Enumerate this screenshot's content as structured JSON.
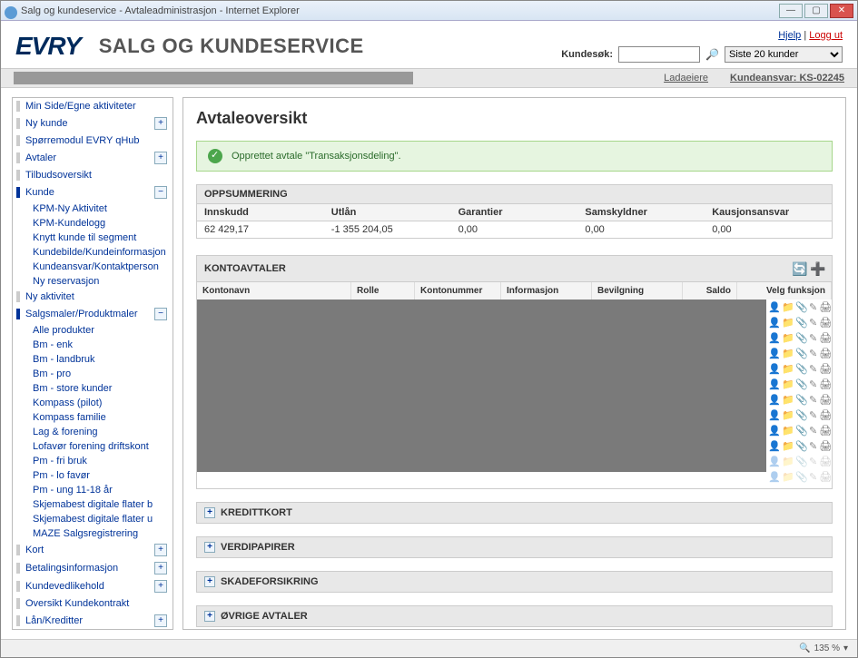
{
  "window": {
    "title": "Salg og kundeservice - Avtaleadministrasjon - Internet Explorer"
  },
  "header": {
    "logo": "EVRY",
    "app_title": "SALG OG KUNDESERVICE",
    "help": "Hjelp",
    "logout": "Logg ut",
    "search_label": "Kundesøk:",
    "search_value": "",
    "recent_select": "Siste 20 kunder"
  },
  "toolbar": {
    "ladaeiere": "Ladaeiere",
    "kundeansvar_label": "Kundeansvar:",
    "kundeansvar_value": "KS-02245"
  },
  "sidebar": {
    "items": [
      {
        "label": "Min Side/Egne aktiviteter",
        "type": "top"
      },
      {
        "label": "Ny kunde",
        "type": "top",
        "toggle": "+"
      },
      {
        "label": "Spørremodul EVRY qHub",
        "type": "top"
      },
      {
        "label": "Avtaler",
        "type": "top",
        "toggle": "+"
      },
      {
        "label": "Tilbudsoversikt",
        "type": "top"
      },
      {
        "label": "Kunde",
        "type": "top",
        "toggle": "−",
        "active": true
      },
      {
        "label": "KPM-Ny Aktivitet",
        "type": "sub"
      },
      {
        "label": "KPM-Kundelogg",
        "type": "sub"
      },
      {
        "label": "Knytt kunde til segment",
        "type": "sub"
      },
      {
        "label": "Kundebilde/Kundeinformasjon",
        "type": "sub"
      },
      {
        "label": "Kundeansvar/Kontaktperson",
        "type": "sub"
      },
      {
        "label": "Ny reservasjon",
        "type": "sub"
      },
      {
        "label": "Ny aktivitet",
        "type": "top"
      },
      {
        "label": "Salgsmaler/Produktmaler",
        "type": "top",
        "toggle": "−",
        "active": true
      },
      {
        "label": "Alle produkter",
        "type": "sub"
      },
      {
        "label": "Bm - enk",
        "type": "sub"
      },
      {
        "label": "Bm - landbruk",
        "type": "sub"
      },
      {
        "label": "Bm - pro",
        "type": "sub"
      },
      {
        "label": "Bm - store kunder",
        "type": "sub"
      },
      {
        "label": "Kompass (pilot)",
        "type": "sub"
      },
      {
        "label": "Kompass familie",
        "type": "sub"
      },
      {
        "label": "Lag & forening",
        "type": "sub"
      },
      {
        "label": "Lofavør forening driftskont",
        "type": "sub"
      },
      {
        "label": "Pm - fri bruk",
        "type": "sub"
      },
      {
        "label": "Pm - lo favør",
        "type": "sub"
      },
      {
        "label": "Pm - ung 11-18 år",
        "type": "sub"
      },
      {
        "label": "Skjemabest digitale flater b",
        "type": "sub"
      },
      {
        "label": "Skjemabest digitale flater u",
        "type": "sub"
      },
      {
        "label": "MAZE Salgsregistrering",
        "type": "sub"
      },
      {
        "label": "Kort",
        "type": "top",
        "toggle": "+"
      },
      {
        "label": "Betalingsinformasjon",
        "type": "top",
        "toggle": "+"
      },
      {
        "label": "Kundevedlikehold",
        "type": "top",
        "toggle": "+"
      },
      {
        "label": "Oversikt Kundekontrakt",
        "type": "top"
      },
      {
        "label": "Lån/Kreditter",
        "type": "top",
        "toggle": "+"
      }
    ]
  },
  "panel": {
    "title": "Avtaleoversikt",
    "alert": "Opprettet avtale \"Transaksjonsdeling\".",
    "summary": {
      "heading": "OPPSUMMERING",
      "cols": [
        "Innskudd",
        "Utlån",
        "Garantier",
        "Samskyldner",
        "Kausjonsansvar"
      ],
      "vals": [
        "62 429,17",
        "-1 355 204,05",
        "0,00",
        "0,00",
        "0,00"
      ]
    },
    "konto": {
      "heading": "KONTOAVTALER",
      "cols": [
        "Kontonavn",
        "Rolle",
        "Kontonummer",
        "Informasjon",
        "Bevilgning",
        "Saldo",
        "Velg funksjon"
      ]
    },
    "sections": [
      "KREDITTKORT",
      "VERDIPAPIRER",
      "SKADEFORSIKRING",
      "ØVRIGE AVTALER"
    ]
  },
  "statusbar": {
    "zoom": "135 %"
  }
}
